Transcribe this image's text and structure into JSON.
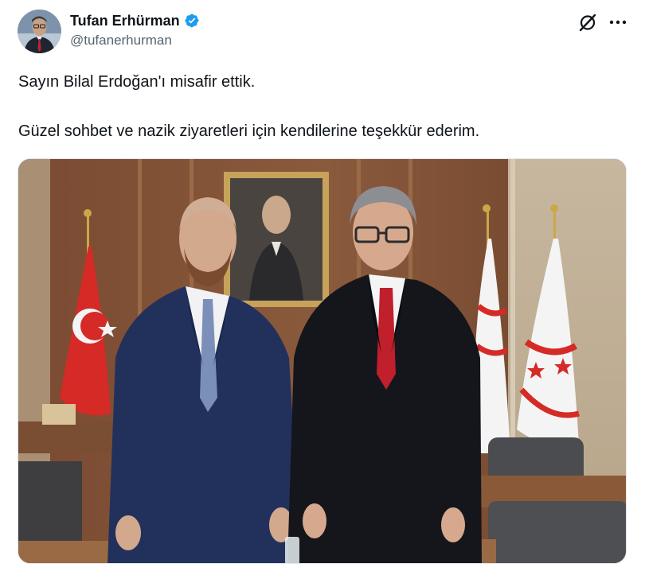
{
  "tweet": {
    "author": {
      "display_name": "Tufan Erhürman",
      "handle": "@tufanerhurman",
      "verified": true
    },
    "text": {
      "line1": "Sayın Bilal Erdoğan'ı misafir ettik.",
      "line2": "Güzel sohbet ve nazik ziyaretleri için kendilerine teşekkür ederim."
    },
    "icons": {
      "verified": "verified-badge-icon",
      "grok": "grok-icon",
      "more": "more-horizontal-icon"
    },
    "colors": {
      "verified_blue": "#1d9bf0",
      "secondary_text": "#536471",
      "primary_text": "#0f1419"
    }
  }
}
